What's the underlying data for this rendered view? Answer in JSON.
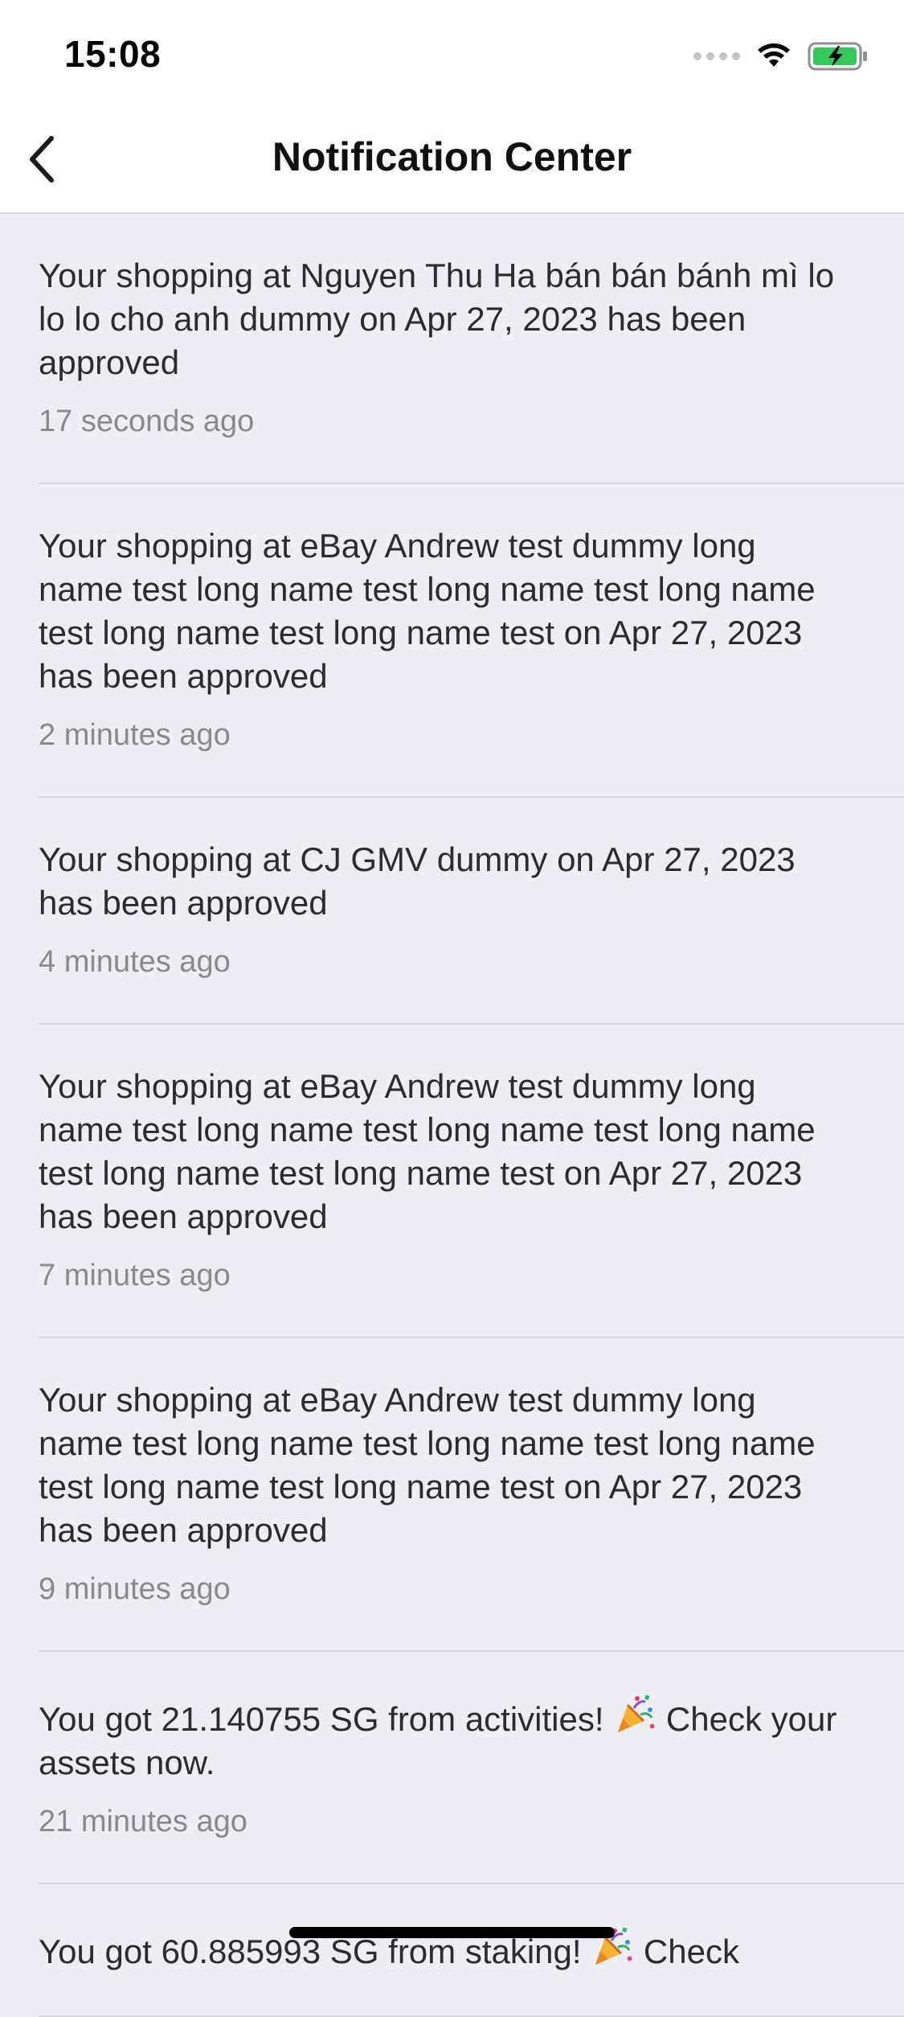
{
  "status_bar": {
    "time": "15:08"
  },
  "nav": {
    "title": "Notification Center"
  },
  "notifications": [
    {
      "message": "Your shopping at Nguyen Thu Ha bán bán bánh mì lo lo lo cho anh dummy on Apr 27, 2023 has been approved",
      "time": "17 seconds ago"
    },
    {
      "message": "Your shopping at eBay Andrew test dummy long name test long name test long name test long name test long name test long name test on Apr 27, 2023 has been approved",
      "time": "2 minutes ago"
    },
    {
      "message": "Your shopping at CJ GMV dummy on Apr 27, 2023 has been approved",
      "time": "4 minutes ago"
    },
    {
      "message": "Your shopping at eBay Andrew test dummy long name test long name test long name test long name test long name test long name test on Apr 27, 2023 has been approved",
      "time": "7 minutes ago"
    },
    {
      "message": "Your shopping at eBay Andrew test dummy long name test long name test long name test long name test long name test long name test on Apr 27, 2023 has been approved",
      "time": "9 minutes ago"
    },
    {
      "message_before": "You got 21.140755 SG from activities!",
      "message_after": "Check your assets now.",
      "time": "21 minutes ago"
    },
    {
      "message_before": "You got 60.885993 SG from staking!",
      "message_after": "Check",
      "time": ""
    }
  ],
  "colors": {
    "background": "#ededf2",
    "header": "#ffffff",
    "battery_fill": "#34c759",
    "timestamp": "#8a8a8e"
  }
}
